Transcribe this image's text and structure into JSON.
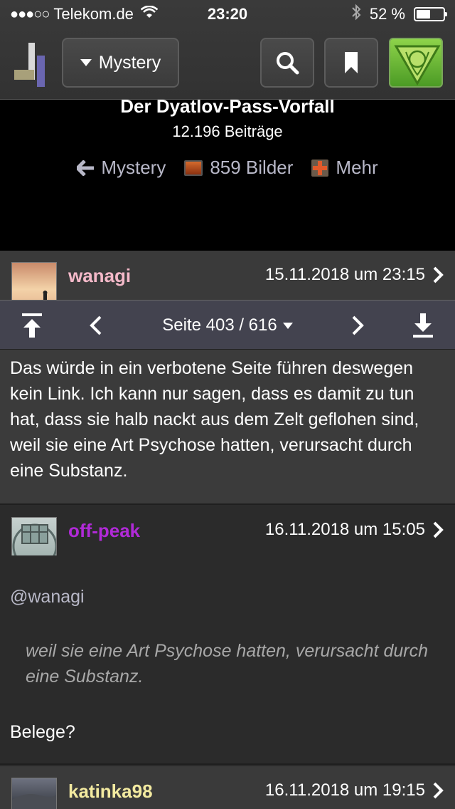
{
  "status_bar": {
    "carrier": "Telekom.de",
    "signal_dots": "●●●○○",
    "time": "23:20",
    "battery": "52 %",
    "battery_level": 0.52
  },
  "header": {
    "forum_button": "Mystery"
  },
  "thread": {
    "title": "Der Dyatlov-Pass-Vorfall",
    "post_count": "12.196 Beiträge",
    "back_link": "Mystery",
    "images_link": "859 Bilder",
    "more_link": "Mehr"
  },
  "pagination": {
    "label": "Seite 403 / 616"
  },
  "posts": [
    {
      "username": "wanagi",
      "date": "15.11.2018 um 23:15",
      "body": "Das würde in ein verbotene Seite führen deswegen kein Link. Ich kann nur sagen, dass es damit zu tun hat, dass sie halb nackt aus dem Zelt geflohen sind, weil sie eine Art Psychose hatten, verursacht durch eine Substanz."
    },
    {
      "username": "off-peak",
      "date": "16.11.2018 um 15:05",
      "mention": "@wanagi",
      "quote": "weil sie eine Art Psychose hatten, verursacht durch eine Substanz.",
      "body": "Belege?"
    },
    {
      "username": "katinka98",
      "date": "16.11.2018 um 19:15"
    }
  ],
  "colors": {
    "user_wanagi": "#f4b9c9",
    "user_offpeak": "#b12ad8",
    "user_katinka": "#f3eaa0",
    "accent_orange": "#e25a2a"
  }
}
